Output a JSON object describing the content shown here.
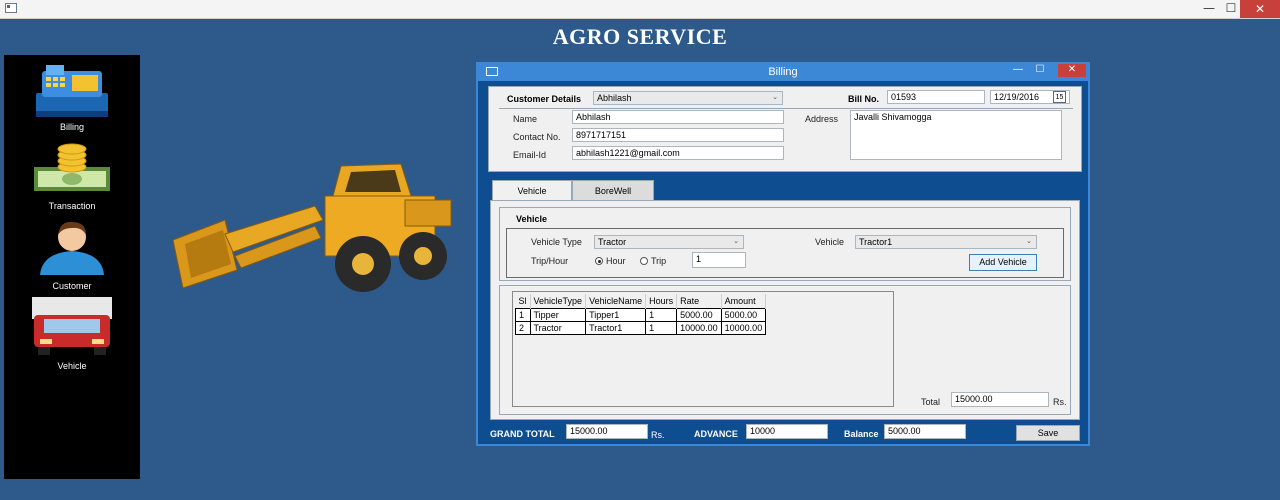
{
  "window": {
    "controls": {
      "minimize": "—",
      "maximize": "☐",
      "close": "✕"
    }
  },
  "app_title": "AGRO SERVICE",
  "sidebar": {
    "items": [
      {
        "label": "Billing",
        "icon": "cash-register-icon"
      },
      {
        "label": "Transaction",
        "icon": "coins-icon"
      },
      {
        "label": "Customer",
        "icon": "user-icon"
      },
      {
        "label": "Vehicle",
        "icon": "truck-icon"
      }
    ]
  },
  "hero": {
    "icon": "backhoe-loader-icon"
  },
  "billing": {
    "title": "Billing",
    "controls": {
      "minimize": "—",
      "maximize": "☐",
      "close": "✕"
    },
    "customer_details_label": "Customer Details",
    "customer_selected": "Abhilash",
    "bill_no_label": "Bill No.",
    "bill_no": "01593",
    "date": "12/19/2016",
    "calendar_day": "15",
    "name_label": "Name",
    "name": "Abhilash",
    "contact_label": "Contact No.",
    "contact": "8971717151",
    "email_label": "Email-Id",
    "email": "abhilash1221@gmail.com",
    "address_label": "Address",
    "address": "Javalli Shivamogga",
    "tabs": [
      {
        "label": "Vehicle",
        "active": true
      },
      {
        "label": "BoreWell",
        "active": false
      }
    ],
    "vehicle_section_title": "Vehicle",
    "vehicle_type_label": "Vehicle Type",
    "vehicle_type": "Tractor",
    "vehicle_label": "Vehicle",
    "vehicle": "Tractor1",
    "trip_hour_label": "Trip/Hour",
    "radio_hour": "Hour",
    "radio_trip": "Trip",
    "selected_mode": "Hour",
    "qty": "1",
    "add_vehicle_label": "Add Vehicle",
    "grid": {
      "columns": [
        "Sl",
        "VehicleType",
        "VehicleName",
        "Hours",
        "Rate",
        "Amount"
      ],
      "rows": [
        [
          "1",
          "Tipper",
          "Tipper1",
          "1",
          "5000.00",
          "5000.00"
        ],
        [
          "2",
          "Tractor",
          "Tractor1",
          "1",
          "10000.00",
          "10000.00"
        ]
      ]
    },
    "total_label": "Total",
    "total": "15000.00",
    "rs_label": "Rs.",
    "grand_total_label": "GRAND TOTAL",
    "grand_total": "15000.00",
    "grand_rs_label": "Rs.",
    "advance_label": "ADVANCE",
    "advance": "10000",
    "balance_label": "Balance",
    "balance": "5000.00",
    "save_label": "Save"
  },
  "colors": {
    "background": "#2d5a8a",
    "sidebar": "#000000",
    "window_border": "#3c87d6",
    "window_body": "#0e4d8f",
    "close": "#c7403a"
  }
}
